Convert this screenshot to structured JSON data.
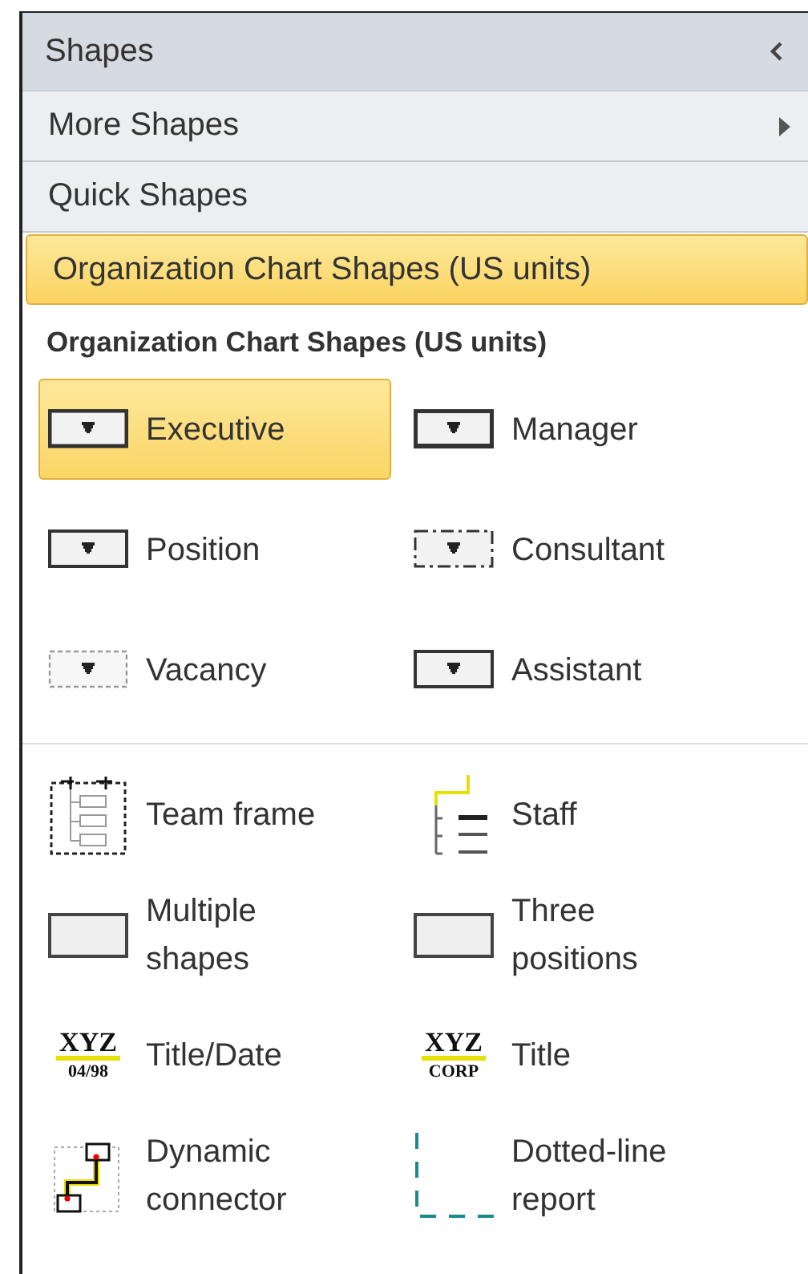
{
  "panel": {
    "title": "Shapes"
  },
  "stencils": [
    {
      "label": "More Shapes",
      "kind": "menu",
      "selected": false
    },
    {
      "label": "Quick Shapes",
      "kind": "stencil",
      "selected": false
    },
    {
      "label": "Organization Chart Shapes (US units)",
      "kind": "stencil",
      "selected": true
    }
  ],
  "stencil_title": "Organization Chart Shapes (US units)",
  "shape_groups": [
    [
      {
        "label": "Executive",
        "kind": "executive",
        "selected": true
      },
      {
        "label": "Manager",
        "kind": "manager",
        "selected": false
      },
      {
        "label": "Position",
        "kind": "position",
        "selected": false
      },
      {
        "label": "Consultant",
        "kind": "consultant",
        "selected": false
      },
      {
        "label": "Vacancy",
        "kind": "vacancy",
        "selected": false
      },
      {
        "label": "Assistant",
        "kind": "assistant",
        "selected": false
      }
    ],
    [
      {
        "label": "Team frame",
        "kind": "team-frame",
        "selected": false
      },
      {
        "label": "Staff",
        "kind": "staff",
        "selected": false
      },
      {
        "label": "Multiple\nshapes",
        "kind": "plain-box",
        "selected": false
      },
      {
        "label": "Three\npositions",
        "kind": "plain-box",
        "selected": false
      },
      {
        "label": "Title/Date",
        "kind": "logo",
        "icon_text": [
          "XYZ",
          "04/98"
        ],
        "selected": false
      },
      {
        "label": "Title",
        "kind": "logo",
        "icon_text": [
          "XYZ",
          "CORP"
        ],
        "selected": false
      },
      {
        "label": "Dynamic\nconnector",
        "kind": "connector",
        "selected": false
      },
      {
        "label": "Dotted-line\nreport",
        "kind": "dotted-line",
        "selected": false
      }
    ]
  ]
}
